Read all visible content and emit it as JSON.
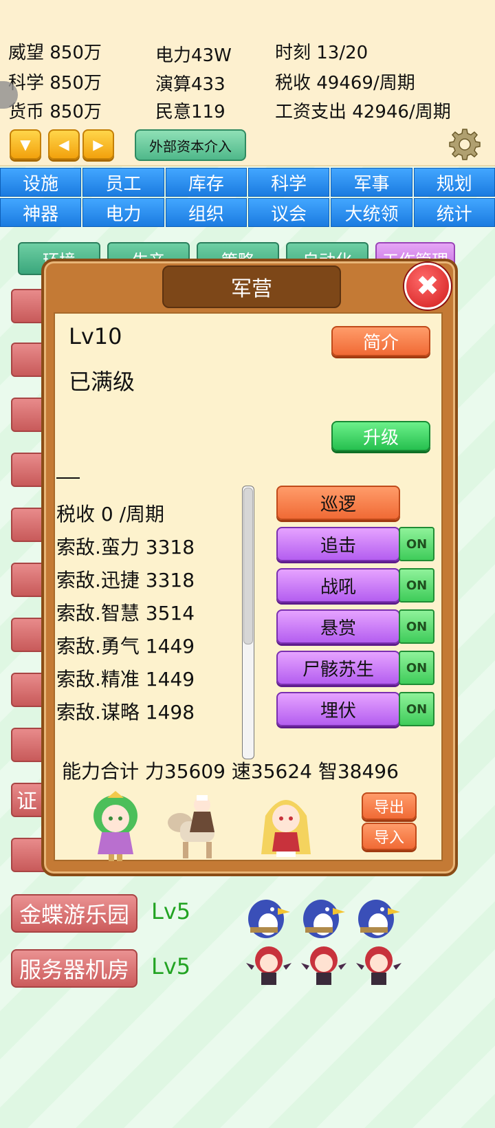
{
  "stats": {
    "prestige": "威望 850万",
    "science": "科学 850万",
    "currency": "货币 850万",
    "power": "电力43W",
    "compute": "演算433",
    "opinion": "民意119",
    "time": "时刻 13/20",
    "tax": "税收 49469/周期",
    "wages": "工资支出 42946/周期"
  },
  "controls": {
    "down_icon": "triangle-down",
    "left_icon": "triangle-left",
    "right_icon": "triangle-right",
    "external_capital": "外部资本介入",
    "settings_icon": "gear"
  },
  "tabs_row1": [
    "设施",
    "员工",
    "库存",
    "科学",
    "军事",
    "规划"
  ],
  "tabs_row2": [
    "神器",
    "电力",
    "组织",
    "议会",
    "大统领",
    "统计"
  ],
  "subtabs": [
    "环境",
    "生产",
    "策略",
    "自动化",
    "工作管理"
  ],
  "behind": {
    "partial_label": "证",
    "facilities": [
      {
        "name": "金蝶游乐园",
        "level": "Lv5"
      },
      {
        "name": "服务器机房",
        "level": "Lv5"
      }
    ]
  },
  "dialog": {
    "title": "军营",
    "close_icon": "close-x",
    "level": "Lv10",
    "status": "已满级",
    "intro_button": "简介",
    "upgrade_button": "升级",
    "stat_lines": [
      "税收 0 /周期",
      "索敌.蛮力 3318",
      "索敌.迅捷 3318",
      "索敌.智慧 3514",
      "索敌.勇气 1449",
      "索敌.精准 1449",
      "索敌.谋略 1498"
    ],
    "patrol_button": "巡逻",
    "skills": [
      {
        "label": "追击",
        "toggle": "ON"
      },
      {
        "label": "战吼",
        "toggle": "ON"
      },
      {
        "label": "悬赏",
        "toggle": "ON"
      },
      {
        "label": "尸骸苏生",
        "toggle": "ON"
      },
      {
        "label": "埋伏",
        "toggle": "ON"
      }
    ],
    "totals": "能力合计 力35609 速35624 智38496",
    "export_button": "导出",
    "import_button": "导入"
  },
  "colors": {
    "tab_blue": "#1b7be0",
    "dialog_wood": "#c47a35",
    "panel_cream": "#fdf2cd",
    "skill_purple": "#b45ef0",
    "toggle_green": "#3fcc5a",
    "level_green": "#22a322"
  }
}
